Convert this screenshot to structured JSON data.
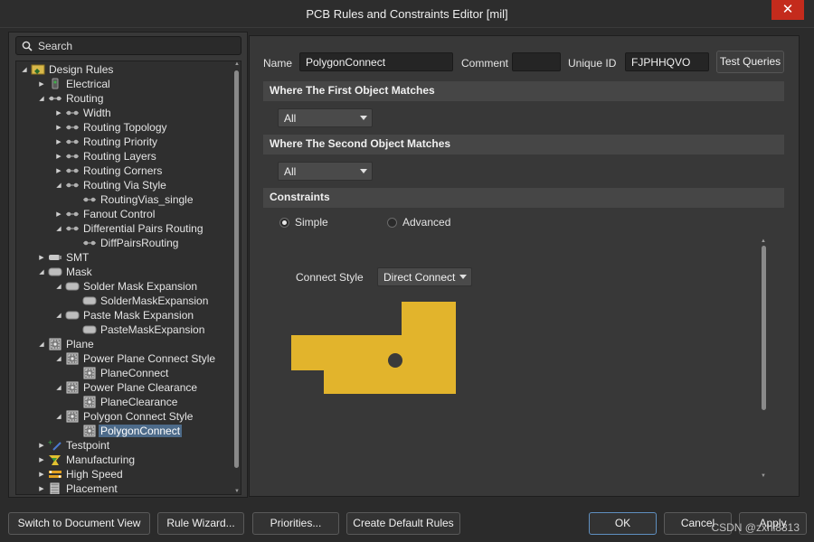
{
  "window": {
    "title": "PCB Rules and Constraints Editor [mil]",
    "close_glyph": "✕"
  },
  "search": {
    "placeholder": "Search"
  },
  "tree": [
    {
      "label": "Design Rules",
      "icon": "design-rules-icon"
    },
    {
      "label": "Electrical",
      "icon": "electrical-icon"
    },
    {
      "label": "Routing",
      "icon": "routing-icon"
    },
    {
      "label": "Width",
      "icon": "rule-icon"
    },
    {
      "label": "Routing Topology",
      "icon": "rule-icon"
    },
    {
      "label": "Routing Priority",
      "icon": "rule-icon"
    },
    {
      "label": "Routing Layers",
      "icon": "rule-icon"
    },
    {
      "label": "Routing Corners",
      "icon": "rule-icon"
    },
    {
      "label": "Routing Via Style",
      "icon": "rule-icon"
    },
    {
      "label": "RoutingVias_single",
      "icon": "rule-icon"
    },
    {
      "label": "Fanout Control",
      "icon": "rule-icon"
    },
    {
      "label": "Differential Pairs Routing",
      "icon": "rule-icon"
    },
    {
      "label": "DiffPairsRouting",
      "icon": "rule-icon"
    },
    {
      "label": "SMT",
      "icon": "smt-icon"
    },
    {
      "label": "Mask",
      "icon": "mask-icon"
    },
    {
      "label": "Solder Mask Expansion",
      "icon": "mask-icon"
    },
    {
      "label": "SolderMaskExpansion",
      "icon": "mask-icon"
    },
    {
      "label": "Paste Mask Expansion",
      "icon": "mask-icon"
    },
    {
      "label": "PasteMaskExpansion",
      "icon": "mask-icon"
    },
    {
      "label": "Plane",
      "icon": "plane-icon"
    },
    {
      "label": "Power Plane Connect Style",
      "icon": "plane-icon"
    },
    {
      "label": "PlaneConnect",
      "icon": "plane-icon"
    },
    {
      "label": "Power Plane Clearance",
      "icon": "plane-icon"
    },
    {
      "label": "PlaneClearance",
      "icon": "plane-icon"
    },
    {
      "label": "Polygon Connect Style",
      "icon": "plane-icon"
    },
    {
      "label": "PolygonConnect",
      "icon": "plane-icon"
    },
    {
      "label": "Testpoint",
      "icon": "testpoint-icon"
    },
    {
      "label": "Manufacturing",
      "icon": "manufacturing-icon"
    },
    {
      "label": "High Speed",
      "icon": "high-speed-icon"
    },
    {
      "label": "Placement",
      "icon": "placement-icon"
    }
  ],
  "rule": {
    "name_label": "Name",
    "name_value": "PolygonConnect",
    "comment_label": "Comment",
    "comment_value": "",
    "unique_id_label": "Unique ID",
    "unique_id_value": "FJPHHQVO",
    "test_queries_label": "Test Queries"
  },
  "sections": {
    "first_match": "Where The First Object Matches",
    "first_match_value": "All",
    "second_match": "Where The Second Object Matches",
    "second_match_value": "All",
    "constraints": "Constraints"
  },
  "constraints": {
    "simple_label": "Simple",
    "advanced_label": "Advanced",
    "mode": "Simple",
    "connect_style_label": "Connect Style",
    "connect_style_value": "Direct Connect"
  },
  "colors": {
    "copper": "#e2b42c",
    "accent_selection": "#4c6d8f"
  },
  "footer": {
    "switch_view": "Switch to Document View",
    "rule_wizard": "Rule Wizard...",
    "priorities": "Priorities...",
    "create_default": "Create Default Rules",
    "ok": "OK",
    "cancel": "Cancel",
    "apply": "Apply",
    "watermark": "CSDN @zxhl8313"
  }
}
